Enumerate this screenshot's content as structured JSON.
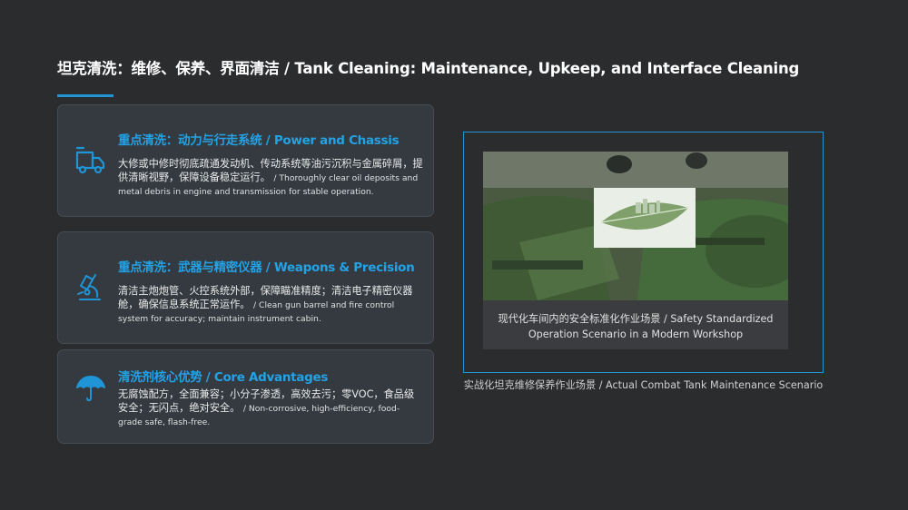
{
  "slide": {
    "title": "坦克清洗：维修、保养、界面清洁 / Tank Cleaning: Maintenance, Upkeep, and Interface Cleaning",
    "accent_color": "#1f95d6"
  },
  "cards": [
    {
      "icon": "truck-icon",
      "heading": "重点清洗：动力与行走系统 / Power and Chassis",
      "desc_zh": "大修或中修时彻底疏通发动机、传动系统等油污沉积与金属碎屑，提供清晰视野，保障设备稳定运行。",
      "desc_en": "/ Thoroughly clear oil deposits and metal debris in engine and transmission for stable operation."
    },
    {
      "icon": "microscope-icon",
      "heading": "重点清洗：武器与精密仪器 / Weapons & Precision",
      "desc_zh": "清洁主炮炮管、火控系统外部，保障瞄准精度；清洁电子精密仪器舱，确保信息系统正常运作。",
      "desc_en": "/ Clean gun barrel and fire control system for accuracy; maintain instrument cabin."
    },
    {
      "icon": "umbrella-icon",
      "heading": "清洗剂核心优势 / Core Advantages",
      "desc_zh": "无腐蚀配方，全面兼容；小分子渗透，高效去污；零VOC，食品级安全；无闪点，绝对安全。",
      "desc_en": "/ Non-corrosive, high-efficiency, food-grade safe, flash-free."
    }
  ],
  "figure": {
    "image_caption": "现代化车间内的安全标准化作业场景 / Safety Standardized Operation Scenario in a Modern Workshop",
    "caption": "实战化坦克维修保养作业场景 / Actual Combat Tank Maintenance Scenario"
  }
}
